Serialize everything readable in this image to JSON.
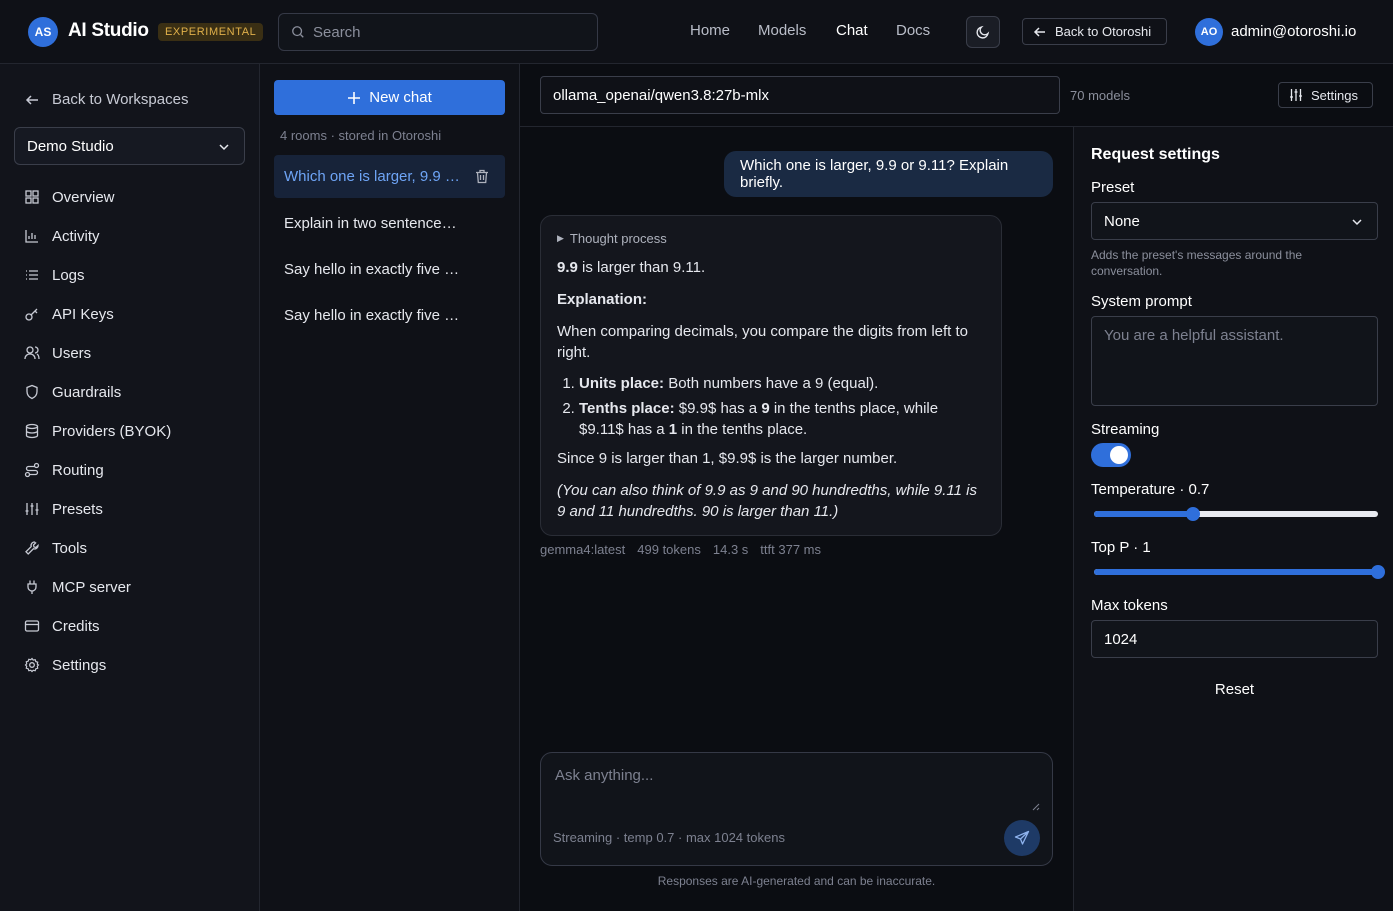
{
  "app": {
    "logo_initials": "AS",
    "title": "AI Studio",
    "badge": "EXPERIMENTAL",
    "accent_color": "#2f6fdb"
  },
  "search": {
    "placeholder": "Search"
  },
  "nav": [
    {
      "label": "Home",
      "active": false
    },
    {
      "label": "Models",
      "active": false
    },
    {
      "label": "Chat",
      "active": true
    },
    {
      "label": "Docs",
      "active": false
    }
  ],
  "header": {
    "theme_icon": "moon-icon",
    "back_label": "Back to Otoroshi",
    "user_initials": "AO",
    "user_email": "admin@otoroshi.io"
  },
  "sidebar": {
    "back_label": "Back to Workspaces",
    "workspace": "Demo Studio",
    "items": [
      {
        "label": "Overview",
        "icon": "grid-icon"
      },
      {
        "label": "Activity",
        "icon": "bar-chart-icon"
      },
      {
        "label": "Logs",
        "icon": "list-icon"
      },
      {
        "label": "API Keys",
        "icon": "key-icon"
      },
      {
        "label": "Users",
        "icon": "users-icon"
      },
      {
        "label": "Guardrails",
        "icon": "shield-icon"
      },
      {
        "label": "Providers (BYOK)",
        "icon": "database-icon"
      },
      {
        "label": "Routing",
        "icon": "route-icon"
      },
      {
        "label": "Presets",
        "icon": "sliders-icon"
      },
      {
        "label": "Tools",
        "icon": "wrench-icon"
      },
      {
        "label": "MCP server",
        "icon": "plug-icon"
      },
      {
        "label": "Credits",
        "icon": "credit-card-icon"
      },
      {
        "label": "Settings",
        "icon": "gear-icon"
      }
    ]
  },
  "rooms": {
    "new_chat_label": "New chat",
    "meta": "4 rooms · stored in Otoroshi",
    "items": [
      {
        "label": "Which one is larger, 9.9 or…",
        "active": true
      },
      {
        "label": "Explain in two sentences …",
        "active": false
      },
      {
        "label": "Say hello in exactly five w…",
        "active": false
      },
      {
        "label": "Say hello in exactly five w…",
        "active": false
      }
    ]
  },
  "model_bar": {
    "model": "ollama_openai/qwen3.8:27b-mlx",
    "count": "70 models",
    "settings_label": "Settings"
  },
  "chat": {
    "user_message": "Which one is larger, 9.9 or 9.11? Explain briefly.",
    "thought_label": "Thought process",
    "answer": {
      "lead_bold": "9.9",
      "lead_rest": " is larger than 9.11.",
      "explanation_heading": "Explanation:",
      "intro": "When comparing decimals, you compare the digits from left to right.",
      "steps": [
        {
          "bold": "Units place:",
          "rest": " Both numbers have a 9 (equal)."
        },
        {
          "bold": "Tenths place:",
          "rest_a": " $9.9$ has a ",
          "bold2": "9",
          "rest_b": " in the tenths place, while $9.11$ has a ",
          "bold3": "1",
          "rest_c": " in the tenths place."
        }
      ],
      "conclusion": "Since 9 is larger than 1, $9.9$ is the larger number.",
      "note": "(You can also think of 9.9 as 9 and 90 hundredths, while 9.11 is 9 and 11 hundredths. 90 is larger than 11.)"
    },
    "meta": {
      "model": "gemma4:latest",
      "tokens": "499 tokens",
      "duration": "14.3 s",
      "ttft": "ttft 377 ms"
    },
    "composer_placeholder": "Ask anything...",
    "composer_meta": "Streaming · temp 0.7 · max 1024 tokens",
    "disclaimer": "Responses are AI-generated and can be inaccurate."
  },
  "settings": {
    "title": "Request settings",
    "preset_label": "Preset",
    "preset_value": "None",
    "preset_help": "Adds the preset's messages around the conversation.",
    "system_prompt_label": "System prompt",
    "system_prompt_placeholder": "You are a helpful assistant.",
    "streaming_label": "Streaming",
    "streaming_on": true,
    "temperature_label": "Temperature · 0.7",
    "temperature_fraction": 0.35,
    "top_p_label": "Top P · 1",
    "top_p_fraction": 1.0,
    "max_tokens_label": "Max tokens",
    "max_tokens_value": "1024",
    "reset_label": "Reset"
  }
}
